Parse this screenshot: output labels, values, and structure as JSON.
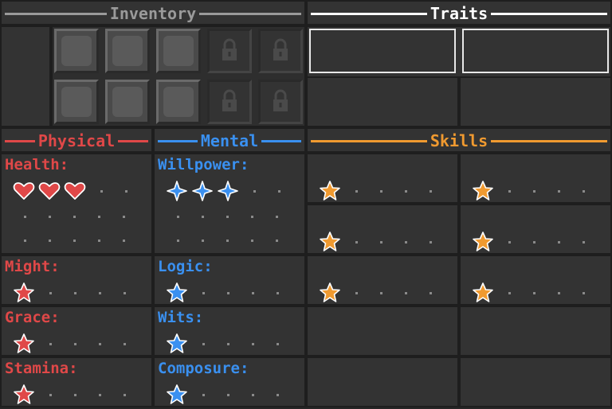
{
  "colors": {
    "physical": "#e04848",
    "mental": "#3a90f0",
    "skills": "#f09a30",
    "inventory": "#9a9a9a",
    "traits": "#ffffff"
  },
  "headers": {
    "inventory": "Inventory",
    "traits": "Traits",
    "physical": "Physical",
    "mental": "Mental",
    "skills": "Skills"
  },
  "inventory": {
    "slots": [
      {
        "locked": false,
        "icon": "empty-slot-icon"
      },
      {
        "locked": false,
        "icon": "empty-slot-icon"
      },
      {
        "locked": false,
        "icon": "empty-slot-icon"
      },
      {
        "locked": true,
        "icon": "lock-icon"
      },
      {
        "locked": true,
        "icon": "lock-icon"
      },
      {
        "locked": false,
        "icon": "empty-slot-icon"
      },
      {
        "locked": false,
        "icon": "empty-slot-icon"
      },
      {
        "locked": false,
        "icon": "empty-slot-icon"
      },
      {
        "locked": true,
        "icon": "lock-icon"
      },
      {
        "locked": true,
        "icon": "lock-icon"
      }
    ]
  },
  "physical": {
    "health": {
      "label": "Health:",
      "value": 3,
      "max": 5,
      "icon": "heart-icon"
    },
    "might": {
      "label": "Might:",
      "value": 1,
      "max": 5,
      "icon": "star-icon"
    },
    "grace": {
      "label": "Grace:",
      "value": 1,
      "max": 5,
      "icon": "star-icon"
    },
    "stamina": {
      "label": "Stamina:",
      "value": 1,
      "max": 5,
      "icon": "star-icon"
    }
  },
  "mental": {
    "willpower": {
      "label": "Willpower:",
      "value": 3,
      "max": 5,
      "icon": "diamond-star-icon"
    },
    "logic": {
      "label": "Logic:",
      "value": 1,
      "max": 5,
      "icon": "star-icon"
    },
    "wits": {
      "label": "Wits:",
      "value": 1,
      "max": 5,
      "icon": "star-icon"
    },
    "composure": {
      "label": "Composure:",
      "value": 1,
      "max": 5,
      "icon": "star-icon"
    }
  },
  "skills": [
    {
      "value": 1,
      "max": 5
    },
    {
      "value": 1,
      "max": 5
    },
    {
      "value": 1,
      "max": 5
    },
    {
      "value": 1,
      "max": 5
    },
    {
      "value": 1,
      "max": 5
    },
    {
      "value": 1,
      "max": 5
    }
  ]
}
